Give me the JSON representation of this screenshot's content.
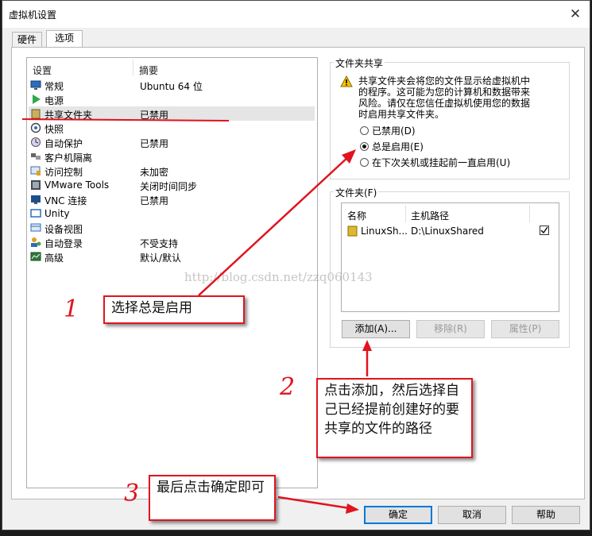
{
  "window": {
    "title": "虚拟机设置",
    "close_glyph": "✕"
  },
  "tabs": [
    {
      "label": "硬件"
    },
    {
      "label": "选项"
    }
  ],
  "settings_list": {
    "col_setting": "设置",
    "col_summary": "摘要",
    "items": [
      {
        "name": "常规",
        "summary": "Ubuntu 64 位",
        "icon": "monitor-icon"
      },
      {
        "name": "电源",
        "summary": "",
        "icon": "play-icon"
      },
      {
        "name": "共享文件夹",
        "summary": "已禁用",
        "icon": "shared-folder-icon"
      },
      {
        "name": "快照",
        "summary": "",
        "icon": "snapshot-icon"
      },
      {
        "name": "自动保护",
        "summary": "已禁用",
        "icon": "autoprotect-icon"
      },
      {
        "name": "客户机隔离",
        "summary": "",
        "icon": "isolation-icon"
      },
      {
        "name": "访问控制",
        "summary": "未加密",
        "icon": "access-control-icon"
      },
      {
        "name": "VMware Tools",
        "summary": "关闭时间同步",
        "icon": "vmware-tools-icon"
      },
      {
        "name": "VNC 连接",
        "summary": "已禁用",
        "icon": "vnc-icon"
      },
      {
        "name": "Unity",
        "summary": "",
        "icon": "unity-icon"
      },
      {
        "name": "设备视图",
        "summary": "",
        "icon": "device-view-icon"
      },
      {
        "name": "自动登录",
        "summary": "不受支持",
        "icon": "autologin-icon"
      },
      {
        "name": "高级",
        "summary": "默认/默认",
        "icon": "advanced-icon"
      }
    ]
  },
  "folder_sharing": {
    "group_label": "文件夹共享",
    "warning_lines": [
      "共享文件夹会将您的文件显示给虚拟机中",
      "的程序。这可能为您的计算机和数据带来",
      "风险。请仅在您信任虚拟机使用您的数据",
      "时启用共享文件夹。"
    ],
    "options": [
      {
        "label": "已禁用(D)",
        "selected": false
      },
      {
        "label": "总是启用(E)",
        "selected": true
      },
      {
        "label": "在下次关机或挂起前一直启用(U)",
        "selected": false
      }
    ]
  },
  "folders": {
    "group_label": "文件夹(F)",
    "col_name": "名称",
    "col_host_path": "主机路径",
    "rows": [
      {
        "name": "LinuxSh...",
        "host_path": "D:\\LinuxShared",
        "enabled": true
      }
    ],
    "add_button": "添加(A)...",
    "remove_button": "移除(R)",
    "properties_button": "属性(P)"
  },
  "footer": {
    "ok_button": "确定",
    "cancel_button": "取消",
    "help_button": "帮助"
  },
  "watermark": "http://blog.csdn.net/zzq060143",
  "annotations": {
    "step1_number": "1",
    "step1_text": "选择总是启用",
    "step2_number": "2",
    "step2_text": "点击添加，然后选择自己已经提前创建好的要共享的文件的路径",
    "step3_number": "3",
    "step3_text": "最后点击确定即可"
  },
  "colors": {
    "annotation_red": "#e0141e",
    "focus_blue": "#0078d7",
    "warning_yellow": "#f5c400"
  }
}
